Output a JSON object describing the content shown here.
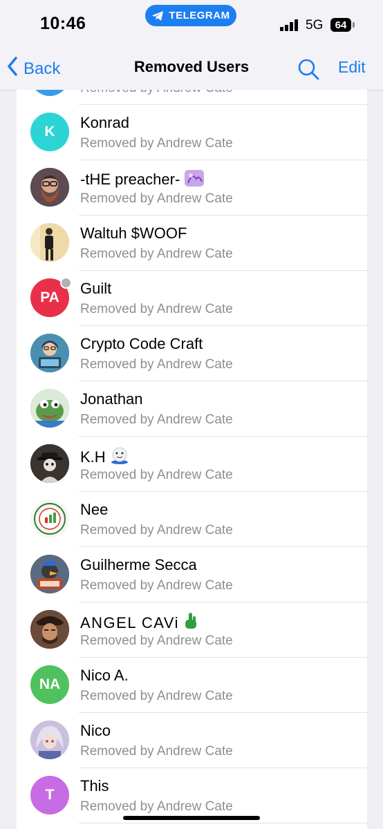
{
  "status_bar": {
    "time": "10:46",
    "app_pill_label": "TELEGRAM",
    "network": "5G",
    "battery": "64"
  },
  "navbar": {
    "back_label": "Back",
    "title": "Removed Users",
    "edit_label": "Edit"
  },
  "colors": {
    "accent": "#1a7cf0",
    "secondary_text": "#8e8e93"
  },
  "partial_row_subtitle": "Removed by Andrew Cate",
  "users": [
    {
      "name": "Konrad",
      "subtitle": "Removed by Andrew Cate",
      "initials": "K",
      "avatar_color": "#2cd4d6"
    },
    {
      "name": "-tHE preacher-",
      "subtitle": "Removed by Andrew Cate",
      "initials": "",
      "avatar_color": "#7a5a55",
      "badge_icon": "purple-sparkle-icon"
    },
    {
      "name": "Waltuh $WOOF",
      "subtitle": "Removed by Andrew Cate",
      "initials": "",
      "avatar_color": "#e8c88c"
    },
    {
      "name": "Guilt",
      "subtitle": "Removed by Andrew Cate",
      "initials": "PA",
      "avatar_color": "#e8304a"
    },
    {
      "name": "Crypto Code Craft",
      "subtitle": "Removed by Andrew Cate",
      "initials": "",
      "avatar_color": "#3f7d9e"
    },
    {
      "name": "Jonathan",
      "subtitle": "Removed by Andrew Cate",
      "initials": "",
      "avatar_color": "#6aa36a"
    },
    {
      "name": "K.H",
      "subtitle": "Removed by Andrew Cate",
      "initials": "",
      "avatar_color": "#3a3330",
      "badge_icon": "white-blue-sticker-icon"
    },
    {
      "name": "Nee",
      "subtitle": "Removed by Andrew Cate",
      "initials": "",
      "avatar_color": "#f4f4f0"
    },
    {
      "name": "Guilherme Secca",
      "subtitle": "Removed by Andrew Cate",
      "initials": "",
      "avatar_color": "#8a4b3a"
    },
    {
      "name": "ANGEL CAVi",
      "subtitle": "Removed by Andrew Cate",
      "initials": "",
      "avatar_color": "#5a3a30",
      "badge_icon": "green-hand-icon"
    },
    {
      "name": "Nico A.",
      "subtitle": "Removed by Andrew Cate",
      "initials": "NA",
      "avatar_color": "#4fc25e"
    },
    {
      "name": "Nico",
      "subtitle": "Removed by Andrew Cate",
      "initials": "",
      "avatar_color": "#b9aecd"
    },
    {
      "name": "This",
      "subtitle": "Removed by Andrew Cate",
      "initials": "T",
      "avatar_color": "#c86ce6"
    }
  ]
}
